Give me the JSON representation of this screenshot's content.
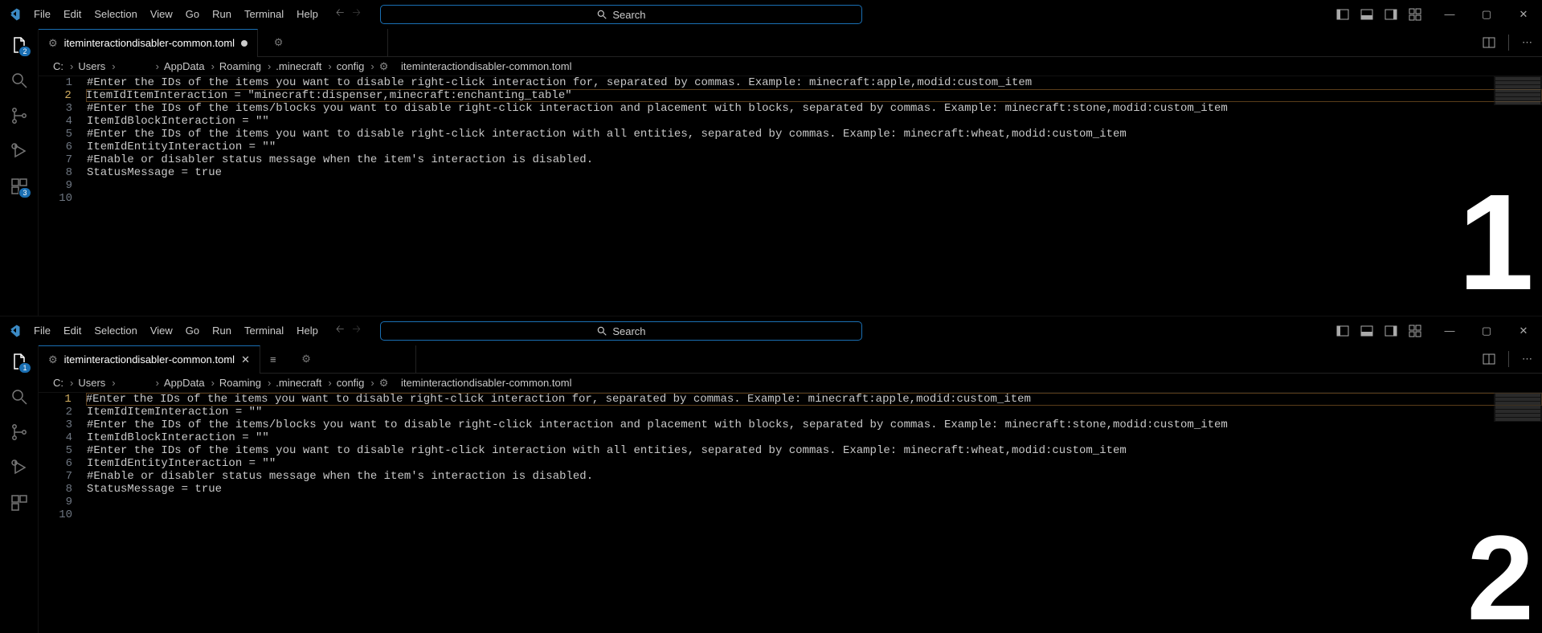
{
  "windows": [
    {
      "menuItems": [
        "File",
        "Edit",
        "Selection",
        "View",
        "Go",
        "Run",
        "Terminal",
        "Help"
      ],
      "searchPlaceholder": "Search",
      "activityBadges": {
        "explorer": "2",
        "ext": "3"
      },
      "tabs": {
        "main": {
          "icon": "gear",
          "label": "iteminteractiondisabler-common.toml",
          "dirty": true,
          "closeVisible": false
        },
        "second": {
          "icon": "gear",
          "dirty": true
        }
      },
      "breadcrumbs": [
        "C:",
        "Users",
        "",
        "AppData",
        "Roaming",
        ".minecraft",
        "config"
      ],
      "breadcrumbFile": "iteminteractiondisabler-common.toml",
      "lines": [
        "#Enter the IDs of the items you want to disable right-click interaction for, separated by commas. Example: minecraft:apple,modid:custom_item",
        "ItemIdItemInteraction = \"minecraft:dispenser,minecraft:enchanting_table\"",
        "#Enter the IDs of the items/blocks you want to disable right-click interaction and placement with blocks, separated by commas. Example: minecraft:stone,modid:custom_item",
        "ItemIdBlockInteraction = \"\"",
        "#Enter the IDs of the items you want to disable right-click interaction with all entities, separated by commas. Example: minecraft:wheat,modid:custom_item",
        "ItemIdEntityInteraction = \"\"",
        "#Enable or disabler status message when the item's interaction is disabled.",
        "StatusMessage = true",
        "",
        ""
      ],
      "currentLine": 2,
      "bigNumber": "1"
    },
    {
      "menuItems": [
        "File",
        "Edit",
        "Selection",
        "View",
        "Go",
        "Run",
        "Terminal",
        "Help"
      ],
      "searchPlaceholder": "Search",
      "activityBadges": {
        "explorer": "1"
      },
      "tabs": {
        "main": {
          "icon": "gear",
          "label": "iteminteractiondisabler-common.toml",
          "dirty": false,
          "closeVisible": true
        },
        "second": {
          "icon": "gear",
          "dirty": true
        }
      },
      "showHamburger": true,
      "breadcrumbs": [
        "C:",
        "Users",
        "",
        "AppData",
        "Roaming",
        ".minecraft",
        "config"
      ],
      "breadcrumbFile": "iteminteractiondisabler-common.toml",
      "lines": [
        "#Enter the IDs of the items you want to disable right-click interaction for, separated by commas. Example: minecraft:apple,modid:custom_item",
        "ItemIdItemInteraction = \"\"",
        "#Enter the IDs of the items/blocks you want to disable right-click interaction and placement with blocks, separated by commas. Example: minecraft:stone,modid:custom_item",
        "ItemIdBlockInteraction = \"\"",
        "#Enter the IDs of the items you want to disable right-click interaction with all entities, separated by commas. Example: minecraft:wheat,modid:custom_item",
        "ItemIdEntityInteraction = \"\"",
        "#Enable or disabler status message when the item's interaction is disabled.",
        "StatusMessage = true",
        "",
        ""
      ],
      "currentLine": 1,
      "bigNumber": "2"
    }
  ]
}
